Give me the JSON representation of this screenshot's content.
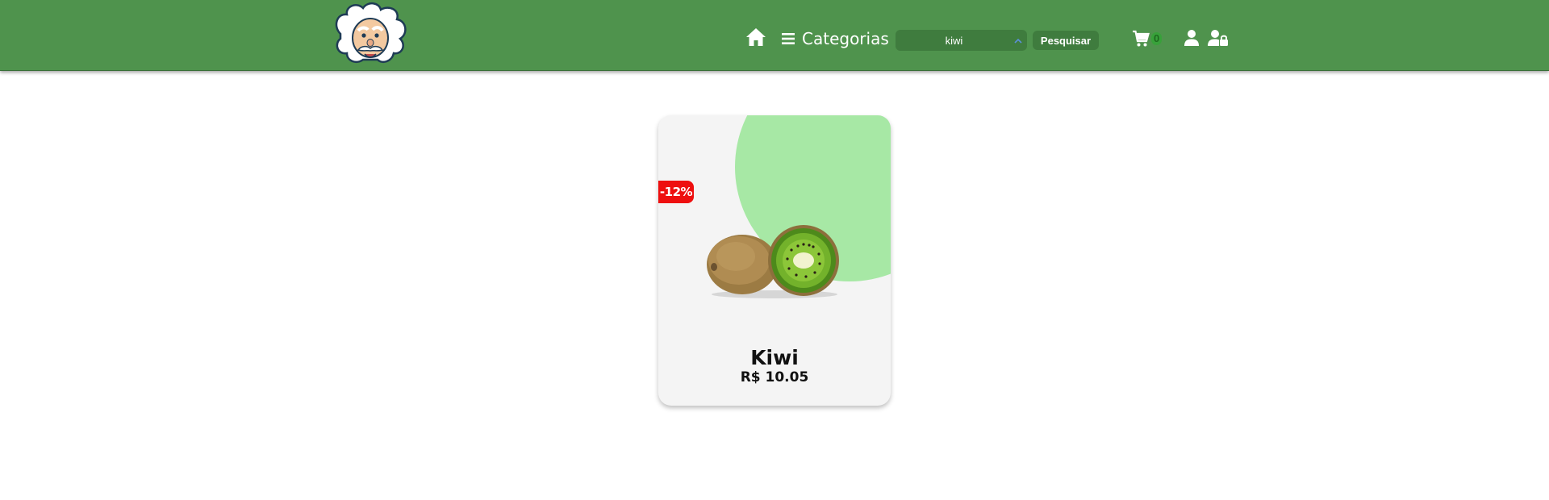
{
  "header": {
    "logo_icon": "scientist-mascot-logo",
    "home_icon": "home-icon",
    "categories_label": "Categorias",
    "search": {
      "value": "kiwi",
      "placeholder": ""
    },
    "search_button_label": "Pesquisar",
    "cart_count": "0"
  },
  "colors": {
    "header_bg": "#4f934d",
    "card_bg": "#f4f4f4",
    "card_blob": "#a7e8a5",
    "discount_badge": "#ee0f0f"
  },
  "products": [
    {
      "name": "Kiwi",
      "price": "R$ 10.05",
      "discount": "-12%"
    }
  ]
}
